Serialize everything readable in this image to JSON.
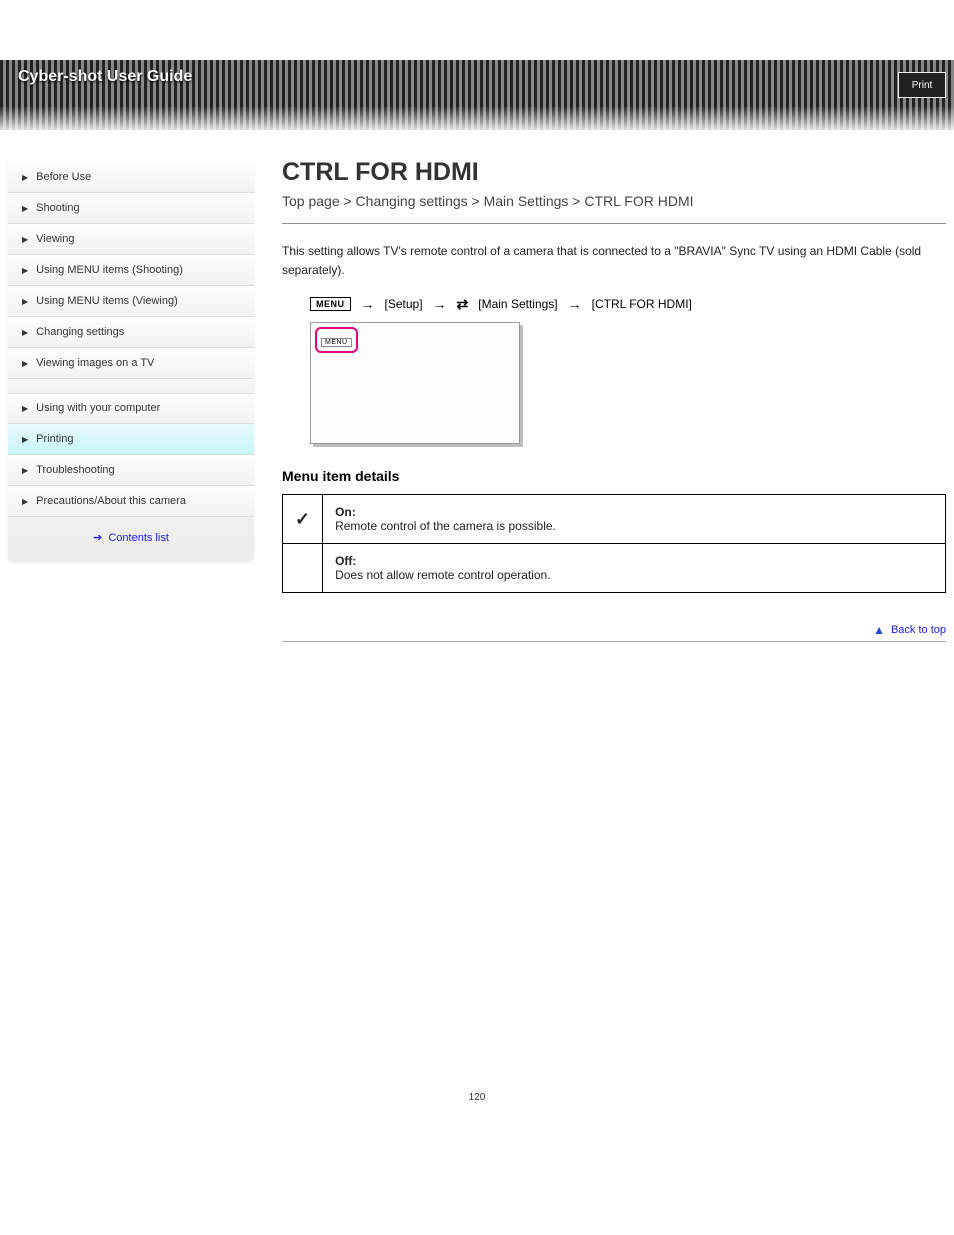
{
  "header": {
    "label": "Cyber-shot User Guide",
    "print_label": "Print"
  },
  "sidebar": {
    "items": [
      {
        "label": "Before Use"
      },
      {
        "label": "Shooting"
      },
      {
        "label": "Viewing"
      },
      {
        "label": "Using MENU items (Shooting)"
      },
      {
        "label": "Using MENU items (Viewing)"
      },
      {
        "label": "Changing settings"
      },
      {
        "label": "Viewing images on a TV"
      },
      {
        "label": "Using with your computer"
      },
      {
        "label": "Printing"
      },
      {
        "label": "Troubleshooting"
      },
      {
        "label": "Precautions/About this camera"
      }
    ],
    "contents_link": "Contents list"
  },
  "main": {
    "title": "CTRL FOR HDMI",
    "crumb": "Top page > Changing settings > Main Settings > CTRL FOR HDMI",
    "description": "This setting allows TV's remote control of a camera that is connected to a \"BRAVIA\" Sync TV using an HDMI Cable (sold separately).",
    "path": {
      "setup_label": "[Setup]",
      "main_settings_label": "[Main Settings]",
      "item_label": "[CTRL FOR HDMI]"
    },
    "menu_badge": "MENU",
    "section_head": "Menu item details",
    "table": {
      "on_label": "On:",
      "on_desc": "Remote control of the camera is possible.",
      "off_label": "Off:",
      "off_desc": "Does not allow remote control operation."
    },
    "back_top": "Back to top"
  },
  "page_number": "120"
}
